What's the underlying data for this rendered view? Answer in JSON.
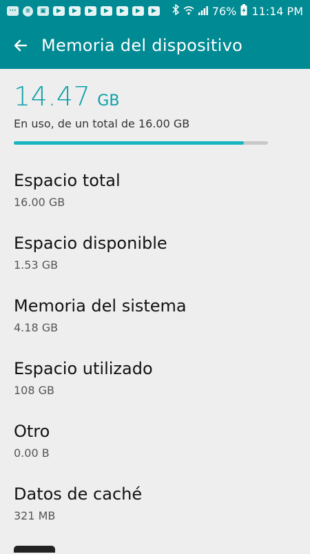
{
  "status_bar": {
    "battery": "76%",
    "time": "11:14 PM",
    "icons": [
      "message-icon",
      "spotify-icon",
      "image-icon",
      "youtube-icon",
      "youtube-icon",
      "youtube-icon",
      "youtube-icon",
      "youtube-icon",
      "youtube-icon",
      "youtube-icon",
      "bluetooth-icon",
      "wifi-icon",
      "signal-icon",
      "battery-charging-icon"
    ]
  },
  "app_bar": {
    "title": "Memoria del dispositivo",
    "back_icon": "arrow-back-icon"
  },
  "usage": {
    "number": "14.47",
    "unit": "GB",
    "caption": "En uso, de un total de 16.00 GB",
    "progress_fraction": 0.9044,
    "accent_color": "#18b4c0"
  },
  "items": [
    {
      "title": "Espacio total",
      "value": "16.00 GB"
    },
    {
      "title": "Espacio disponible",
      "value": "1.53 GB"
    },
    {
      "title": "Memoria del sistema",
      "value": "4.18 GB"
    },
    {
      "title": "Espacio utilizado",
      "value": "108 GB"
    },
    {
      "title": "Otro",
      "value": "0.00 B"
    },
    {
      "title": "Datos de caché",
      "value": "321 MB"
    }
  ],
  "colors": {
    "header": "#008a93",
    "background": "#eeeeee"
  }
}
